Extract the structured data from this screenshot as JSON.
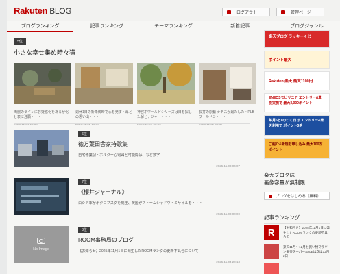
{
  "header": {
    "logo_main": "Rakuten",
    "logo_sub": "BLOG",
    "logout_label": "ログアウト",
    "admin_label": "管理ページ"
  },
  "nav": {
    "tabs": [
      {
        "label": "ブログランキング"
      },
      {
        "label": "記事ランキング"
      },
      {
        "label": "テーマランキング"
      },
      {
        "label": "新着記事"
      },
      {
        "label": "ブログジャンル"
      }
    ]
  },
  "featured": {
    "rank": "5位",
    "title": "小さな幸せ集め時々猫",
    "items": [
      {
        "desc": "両腕のラインにお疑惑化をあるが化と表に注願・・・",
        "date": "2025.11.04 16:38"
      },
      {
        "desc": "週休1日の新衛御時で心を発す・幕との思い出・・・",
        "date": "2025.11.02 15:10"
      },
      {
        "desc": "神宮ホワールドシリーズは日を探した解とナジャー・・・",
        "date": "2025.11.02 08:00"
      },
      {
        "desc": "長打の原動 ナチスが最たした・PLBワールドシ・・・",
        "date": "2025.11.02 05:17"
      }
    ]
  },
  "articles": [
    {
      "rank": "6位",
      "title": "徳万葉田舎家持歌集",
      "desc": "自宅修業記・ホルター心電図と可能開は、など数字",
      "date": "2025.11.03 04:07",
      "noimage": ""
    },
    {
      "rank": "7位",
      "title": "《櫻井ジャーナル》",
      "desc": "ロシア軍がポクロフスクを制圧、英国がストームシャドウ・ミサイルを・・・",
      "date": "2025.11.03 00:00",
      "noimage": ""
    },
    {
      "rank": "8位",
      "title": "ROOM事務局のブログ",
      "desc": "【お知らせ】2025年11月1日に発生したROOMランクの更新不具合について",
      "date": "2025.11.04 20:13",
      "noimage": "No Image"
    }
  ],
  "sidebar": {
    "ads": [
      {
        "text": "楽天ブログ ラッキーくじ"
      },
      {
        "text": "ポイント最大"
      },
      {
        "text": "Rakuten 楽天 最大1100円"
      },
      {
        "text": "ENEOSモビリニア エントリー&車検実施で 最大3,000ポイント"
      },
      {
        "text": "毎月5と0のつく日は エントリー&楽天利用で ポイント3倍"
      },
      {
        "text": "ご紹介&新規お申し込み 最大100万ポイント"
      }
    ],
    "note_line1": "楽天ブログは",
    "note_line2": "画像容量が無制限",
    "start_button": "ブログをはじめる（無料）",
    "ranking_title": "記事ランキング",
    "ranking_items": [
      {
        "text": "【お知らせ】2025年11月1日に発生したROOMランクの更新不具合の"
      },
      {
        "text": "楽天11月〜12月お買い物マラソン楽天スーパーSALEは次は12月2日"
      },
      {
        "text": "・・・"
      }
    ]
  },
  "colors": {
    "brand": "#bf0000",
    "badge": "#3c3c3c"
  }
}
